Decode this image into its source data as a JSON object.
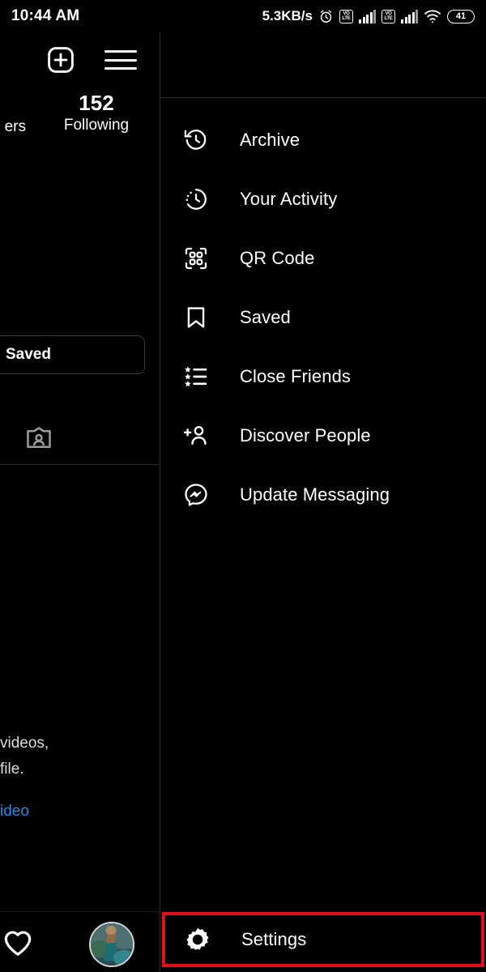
{
  "status_bar": {
    "time": "10:44 AM",
    "net_speed": "5.3KB/s",
    "alarm_icon": "alarm-clock-icon",
    "sim1_label": "VoLTE",
    "sim1_line1": "VO",
    "sim1_line2": "LTE",
    "sim2_line1": "VO",
    "sim2_line2": "LTE",
    "wifi_icon": "wifi-icon",
    "battery_level": "41"
  },
  "profile_panel": {
    "add_icon": "plus-square-icon",
    "menu_icon": "hamburger-menu-icon",
    "stats": {
      "followers_label": "ers",
      "following_count": "152",
      "following_label": "Following"
    },
    "saved_button_label": "Saved",
    "tagged_icon": "tagged-person-icon",
    "bio": {
      "line1": "videos,",
      "line2": "file.",
      "link": "ideo"
    },
    "bottom_nav": {
      "activity_icon": "heart-icon",
      "profile_avatar": "profile-avatar"
    }
  },
  "menu_panel": {
    "items": [
      {
        "label": "Archive",
        "icon": "archive-clock-icon"
      },
      {
        "label": "Your Activity",
        "icon": "activity-clock-icon"
      },
      {
        "label": "QR Code",
        "icon": "qr-code-icon"
      },
      {
        "label": "Saved",
        "icon": "bookmark-icon"
      },
      {
        "label": "Close Friends",
        "icon": "star-list-icon"
      },
      {
        "label": "Discover People",
        "icon": "person-add-icon"
      },
      {
        "label": "Update Messaging",
        "icon": "messenger-icon"
      }
    ],
    "settings": {
      "label": "Settings",
      "icon": "gear-icon",
      "highlight_color": "#e01020"
    }
  }
}
